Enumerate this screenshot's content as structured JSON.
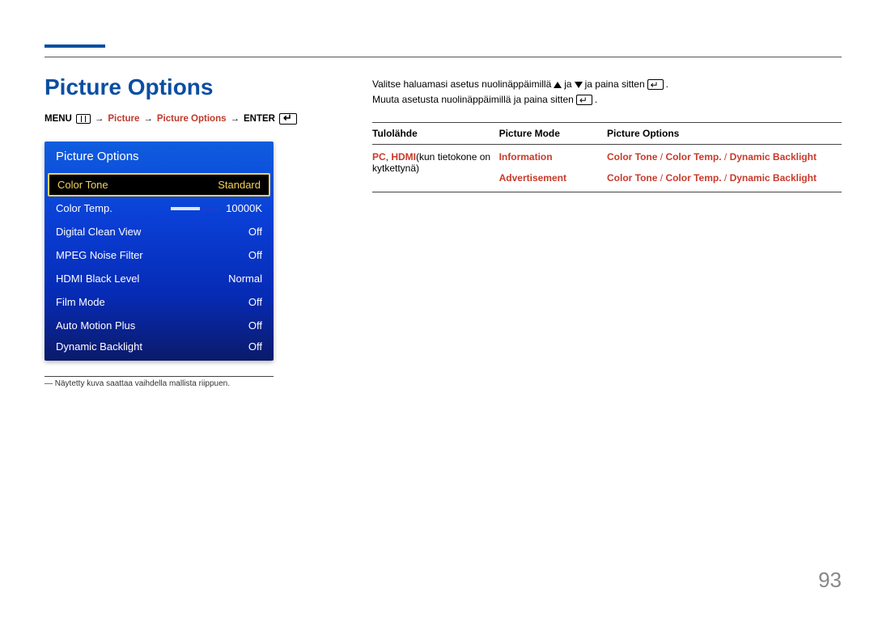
{
  "page": {
    "title": "Picture Options",
    "number": "93",
    "footnote": "― Näytetty kuva saattaa vaihdella mallista riippuen."
  },
  "breadcrumb": {
    "menu_label": "MENU",
    "picture": "Picture",
    "picture_options": "Picture Options",
    "enter_label": "ENTER",
    "arrow": "→"
  },
  "osd": {
    "title": "Picture Options",
    "rows": [
      {
        "label": "Color Tone",
        "value": "Standard",
        "selected": true
      },
      {
        "label": "Color Temp.",
        "value": "10000K",
        "slider_pct": 60
      },
      {
        "label": "Digital Clean View",
        "value": "Off"
      },
      {
        "label": "MPEG Noise Filter",
        "value": "Off"
      },
      {
        "label": "HDMI Black Level",
        "value": "Normal"
      },
      {
        "label": "Film Mode",
        "value": "Off"
      },
      {
        "label": "Auto Motion Plus",
        "value": "Off"
      },
      {
        "label": "Dynamic Backlight",
        "value": "Off"
      }
    ]
  },
  "instructions": {
    "line1a": "Valitse haluamasi asetus nuolinäppäimillä",
    "line1b": "ja",
    "line1c": "ja paina sitten",
    "line1d": ".",
    "line2a": "Muuta asetusta nuolinäppäimillä ja paina sitten",
    "line2b": "."
  },
  "table": {
    "headers": {
      "source": "Tulolähde",
      "mode": "Picture Mode",
      "options": "Picture Options"
    },
    "source_cell": {
      "pc": "PC",
      "sep": ", ",
      "hdmi": "HDMI",
      "note": "(kun tietokone on kytkettynä)"
    },
    "rows": [
      {
        "mode": "Information",
        "options": {
          "a": "Color Tone",
          "b": "Color Temp.",
          "c": "Dynamic Backlight",
          "sep": " / "
        }
      },
      {
        "mode": "Advertisement",
        "options": {
          "a": "Color Tone",
          "b": "Color Temp.",
          "c": "Dynamic Backlight",
          "sep": " / "
        }
      }
    ]
  }
}
